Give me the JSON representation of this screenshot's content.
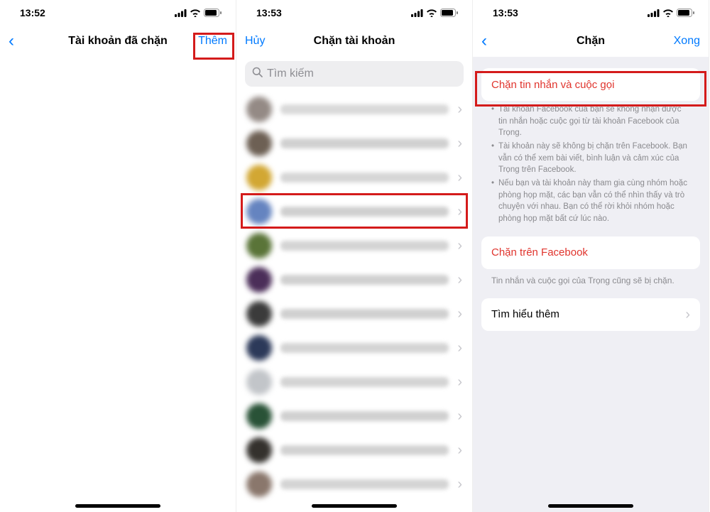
{
  "status": {
    "time_1": "13:52",
    "time_2": "13:53",
    "time_3": "13:53"
  },
  "screen1": {
    "title": "Tài khoản đã chặn",
    "add": "Thêm"
  },
  "screen2": {
    "cancel": "Hủy",
    "title": "Chặn tài khoản",
    "search_placeholder": "Tìm kiếm"
  },
  "screen3": {
    "title": "Chặn",
    "done": "Xong",
    "action_block_msgs": "Chặn tin nhắn và cuộc gọi",
    "bullets": [
      "Tài khoản Facebook của bạn sẽ không nhận được tin nhắn hoặc cuộc gọi từ tài khoản Facebook của Trọng.",
      "Tài khoản này sẽ không bị chặn trên Facebook. Bạn vẫn có thể xem bài viết, bình luận và cảm xúc của Trọng trên Facebook.",
      "Nếu bạn và tài khoản này tham gia cùng nhóm hoặc phòng họp mặt, các bạn vẫn có thể nhìn thấy và trò chuyện với nhau. Bạn có thể rời khỏi nhóm hoặc phòng họp mặt bất cứ lúc nào."
    ],
    "action_block_fb": "Chặn trên Facebook",
    "fb_footnote": "Tin nhắn và cuộc gọi của Trọng cũng sẽ bị chặn.",
    "learn_more": "Tìm hiểu thêm"
  }
}
